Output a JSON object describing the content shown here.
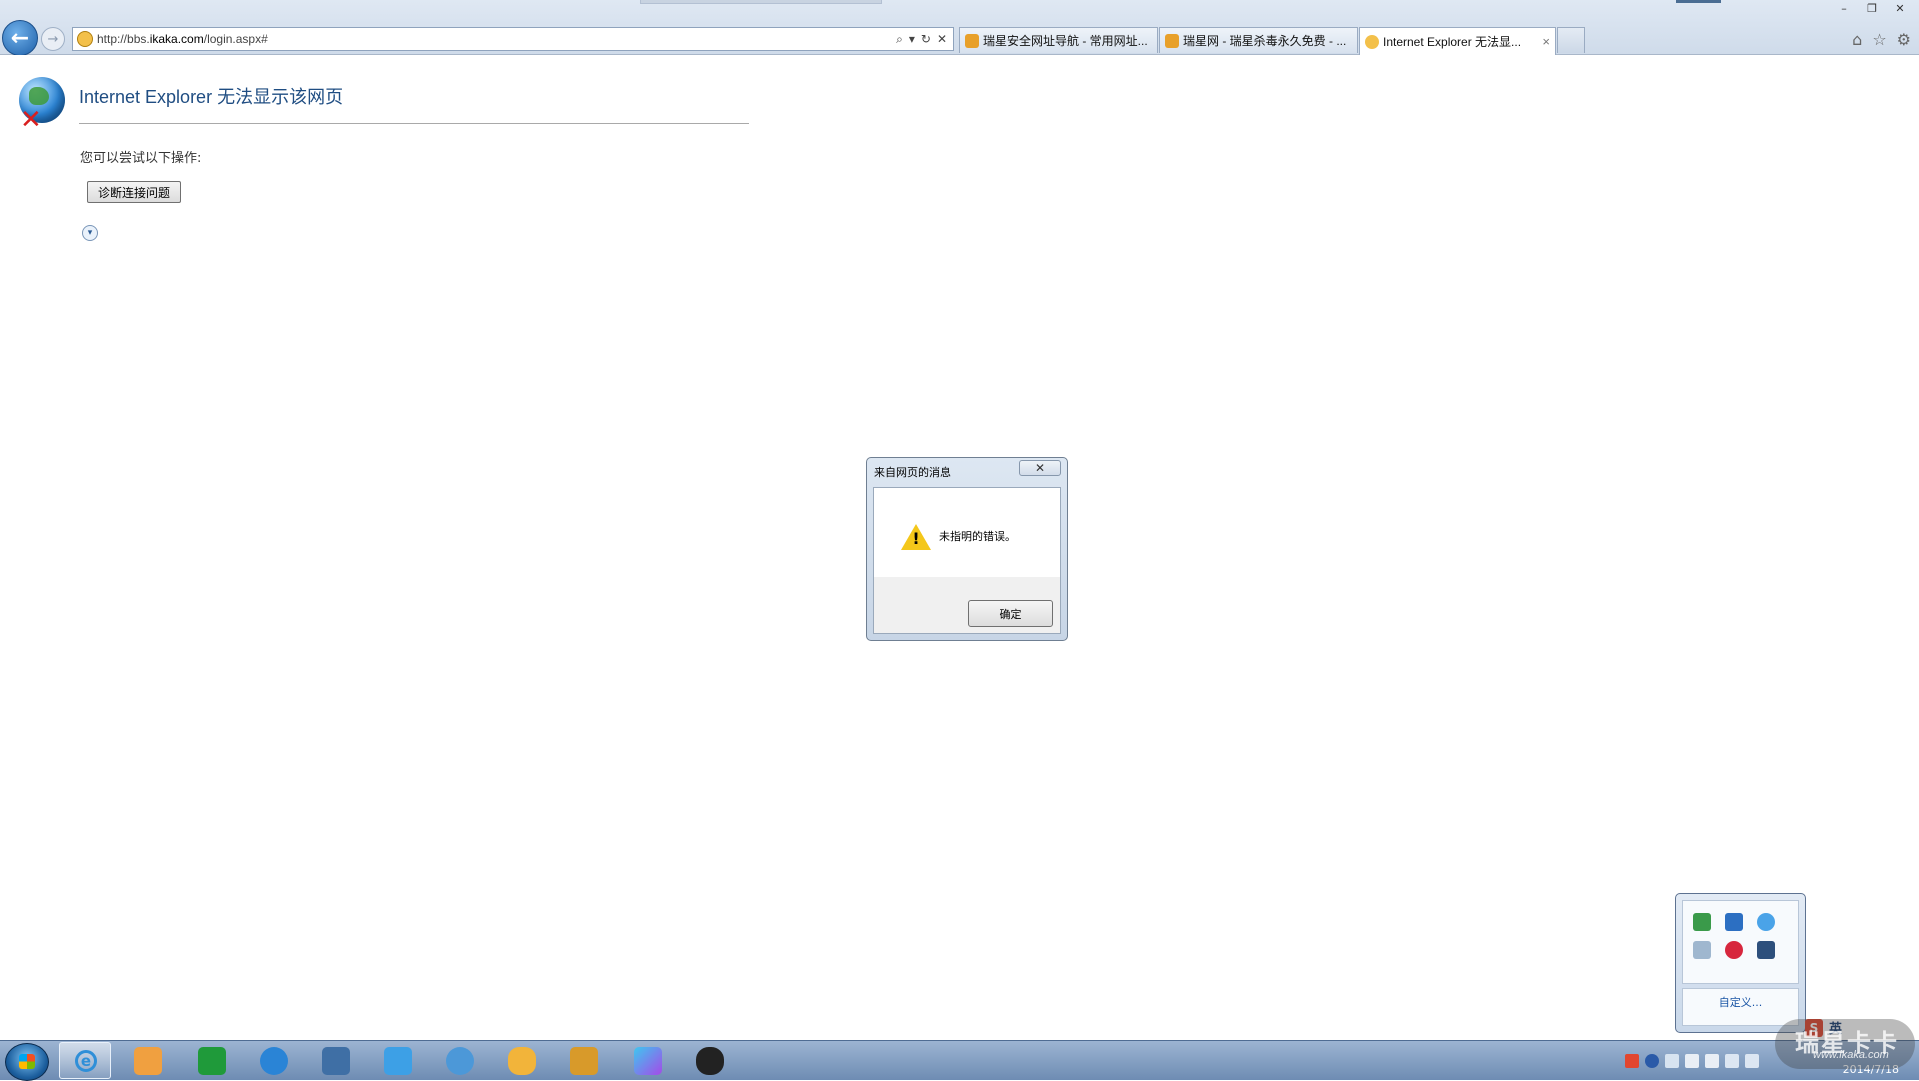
{
  "browser": {
    "address_url_prefix": "http://bbs.",
    "address_url_domain": "ikaka.com",
    "address_url_path": "/login.aspx#",
    "tabs": [
      {
        "label": "瑞星安全网址导航 - 常用网址..."
      },
      {
        "label": "瑞星网 - 瑞星杀毒永久免费 - ..."
      },
      {
        "label": "Internet Explorer 无法显..."
      }
    ],
    "tab_close_glyph": "×",
    "window_controls": {
      "minimize": "–",
      "restore": "❐",
      "close": "✕"
    },
    "toolbar_icons": {
      "home": "⌂",
      "favorites": "☆",
      "tools": "⚙"
    },
    "address_controls": {
      "search": "⌕",
      "dropdown": "▾",
      "refresh": "↻",
      "stop": "✕"
    },
    "back_glyph": "←",
    "forward_glyph": "→"
  },
  "error_page": {
    "title": "Internet Explorer 无法显示该网页",
    "try_text": "您可以尝试以下操作:",
    "diagnose_button": "诊断连接问题",
    "more_info_glyph": "▾"
  },
  "dialog": {
    "title": "来自网页的消息",
    "close_glyph": "✕",
    "message": "未指明的错误。",
    "ok_button": "确定",
    "warning_glyph": "!"
  },
  "tray_popup": {
    "customize_link": "自定义...",
    "icons": [
      "network-icon",
      "window-icon",
      "globe-icon",
      "note-icon",
      "record-icon",
      "shield-icon"
    ]
  },
  "taskbar": {
    "apps": [
      "media-player-icon",
      "green-app-icon",
      "kugou-icon",
      "firewall-icon",
      "bird-app-icon",
      "security-guard-icon",
      "qq-game-icon",
      "lion-shield-icon",
      "play-store-icon",
      "qq-icon"
    ],
    "ime_label": "英",
    "ime_s": "S",
    "date": "2014/7/18",
    "watermark_main": "瑞星卡卡",
    "watermark_url": "www.ikaka.com"
  },
  "colors": {
    "accent": "#1d5fa8",
    "error_title": "#1f4d82",
    "warning": "#f4c71a"
  }
}
